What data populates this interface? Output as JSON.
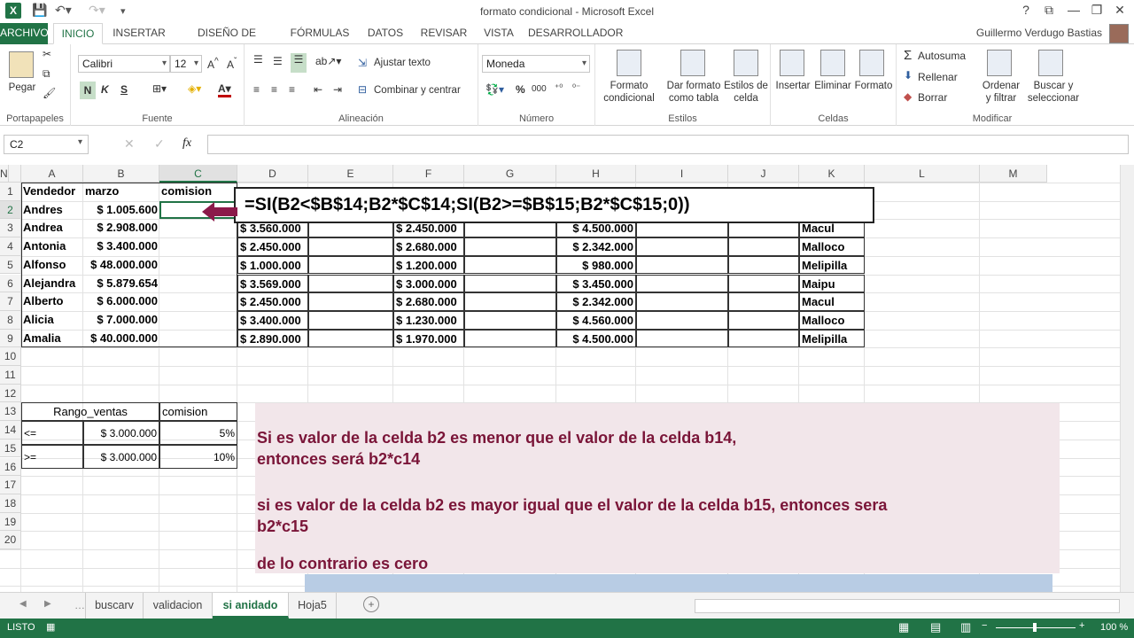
{
  "app": {
    "title": "formato condicional - Microsoft Excel",
    "logo": "X",
    "user": "Guillermo Verdugo Bastias",
    "window_buttons": [
      "?",
      "⧉",
      "—",
      "❐",
      "✕"
    ]
  },
  "menu": {
    "tabs": [
      "ARCHIVO",
      "INICIO",
      "INSERTAR",
      "DISEÑO DE PÁGINA",
      "FÓRMULAS",
      "DATOS",
      "REVISAR",
      "VISTA",
      "DESARROLLADOR"
    ],
    "active": "INICIO"
  },
  "ribbon": {
    "clipboard": {
      "paste": "Pegar",
      "label": "Portapapeles"
    },
    "font": {
      "name": "Calibri",
      "size": "12",
      "bold": "N",
      "italic": "K",
      "underline": "S",
      "label": "Fuente"
    },
    "alignment": {
      "wrap": "Ajustar texto",
      "merge": "Combinar y centrar",
      "label": "Alineación"
    },
    "number": {
      "format": "Moneda",
      "percent": "%",
      "thousands": "000",
      "label": "Número"
    },
    "styles": {
      "conditional": [
        "Formato",
        "condicional"
      ],
      "table": [
        "Dar formato",
        "como tabla"
      ],
      "cell": [
        "Estilos de",
        "celda"
      ],
      "label": "Estilos"
    },
    "cells": {
      "insert": "Insertar",
      "delete": "Eliminar",
      "format": "Formato",
      "label": "Celdas"
    },
    "editing": {
      "autosum": "Autosuma",
      "fill": "Rellenar",
      "clear": "Borrar",
      "sort": [
        "Ordenar",
        "y filtrar"
      ],
      "find": [
        "Buscar y",
        "seleccionar"
      ],
      "label": "Modificar"
    }
  },
  "formula_bar": {
    "name_box": "C2",
    "fx": "fx",
    "cancel": "✕",
    "enter": "✓",
    "content": ""
  },
  "columns": [
    "A",
    "B",
    "C",
    "D",
    "E",
    "F",
    "G",
    "H",
    "I",
    "J",
    "K",
    "L",
    "M",
    "N"
  ],
  "selected_column": "C",
  "rows": [
    "1",
    "2",
    "3",
    "4",
    "5",
    "6",
    "7",
    "8",
    "9",
    "10",
    "11",
    "12",
    "13",
    "14",
    "15",
    "16",
    "17",
    "18",
    "19",
    "20"
  ],
  "selected_row": "2",
  "headers": {
    "a1": "Vendedor",
    "b1": "marzo",
    "c1": "comision"
  },
  "sellers": [
    {
      "name": "Andres",
      "march": "$ 1.005.600"
    },
    {
      "name": "Andrea",
      "march": "$ 2.908.000",
      "d": "$ 3.560.000",
      "f": "$ 2.450.000",
      "h": "$ 4.500.000",
      "k": "Macul"
    },
    {
      "name": "Antonia",
      "march": "$ 3.400.000",
      "d": "$ 2.450.000",
      "f": "$ 2.680.000",
      "h": "$ 2.342.000",
      "k": "Malloco"
    },
    {
      "name": "Alfonso",
      "march": "$ 48.000.000",
      "d": "$ 1.000.000",
      "f": "$ 1.200.000",
      "h": "$ 980.000",
      "k": "Melipilla"
    },
    {
      "name": "Alejandra",
      "march": "$ 5.879.654",
      "d": "$ 3.569.000",
      "f": "$ 3.000.000",
      "h": "$ 3.450.000",
      "k": "Maipu"
    },
    {
      "name": "Alberto",
      "march": "$ 6.000.000",
      "d": "$ 2.450.000",
      "f": "$ 2.680.000",
      "h": "$ 2.342.000",
      "k": "Macul"
    },
    {
      "name": "Alicia",
      "march": "$ 7.000.000",
      "d": "$ 3.400.000",
      "f": "$ 1.230.000",
      "h": "$ 4.560.000",
      "k": "Malloco"
    },
    {
      "name": "Amalia",
      "march": "$ 40.000.000",
      "d": "$ 2.890.000",
      "f": "$ 1.970.000",
      "h": "$ 4.500.000",
      "k": "Melipilla"
    }
  ],
  "range_table": {
    "header_range": "Rango_ventas",
    "header_comm": "comision",
    "rows": [
      {
        "op": "<=",
        "value": "$ 3.000.000",
        "pct": "5%"
      },
      {
        "op": ">=",
        "value": "$ 3.000.000",
        "pct": "10%"
      }
    ]
  },
  "formula_callout": "=SI(B2<$B$14;B2*$C$14;SI(B2>=$B$15;B2*$C$15;0))",
  "explanation": {
    "line1a": "Si es valor de la celda b2 es menor  que el valor de la celda b14,",
    "line1b": "entonces será b2*c14",
    "line2a": "si es valor de la celda b2 es mayor igual que el valor de la celda b15, entonces sera",
    "line2b": "b2*c15",
    "line3": "de lo contrario es cero"
  },
  "sheets": [
    "buscarv",
    "validacion",
    "si anidado",
    "Hoja5"
  ],
  "active_sheet": "si anidado",
  "status": {
    "mode": "LISTO",
    "zoom": "100 %"
  },
  "colors": {
    "excel_green": "#217346",
    "note_text": "#7a1538",
    "note_bg": "#f2e6ea",
    "arrow": "#8b1a4a"
  }
}
